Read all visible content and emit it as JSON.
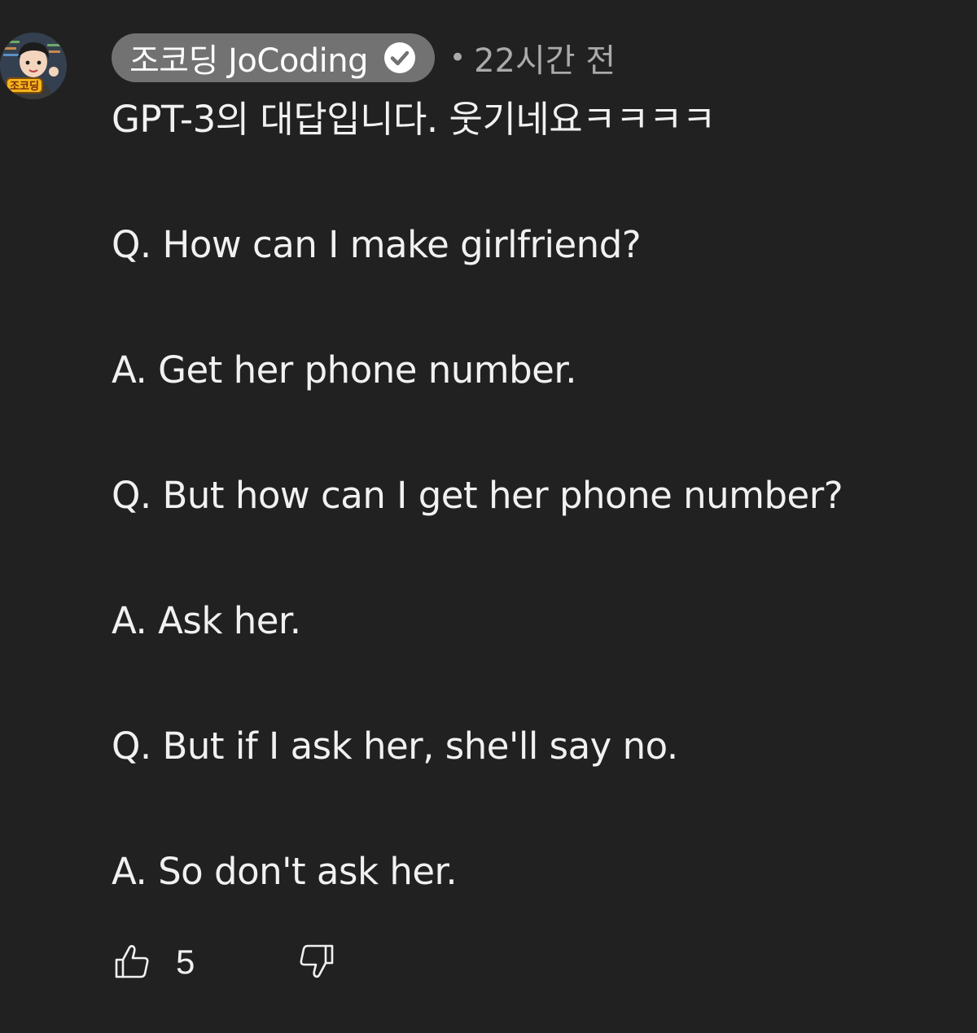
{
  "author": {
    "name": "조코딩 JoCoding",
    "verified": true,
    "avatar_label": "조코딩"
  },
  "meta": {
    "separator": "•",
    "time": "22시간 전"
  },
  "comment": {
    "lines": [
      "GPT-3의 대답입니다. 웃기네요ㅋㅋㅋㅋ",
      "Q. How can I make girlfriend?",
      "A. Get her phone number.",
      "Q. But how can I get her phone number?",
      "A. Ask her.",
      "Q. But if I ask her, she'll say no.",
      "A. So don't ask her."
    ]
  },
  "actions": {
    "like_count": "5",
    "like_icon": "thumbs-up-icon",
    "dislike_icon": "thumbs-down-icon"
  },
  "colors": {
    "background": "#212121",
    "chip": "#727272",
    "text": "#f1f1f1",
    "muted": "#aaaaaa"
  }
}
